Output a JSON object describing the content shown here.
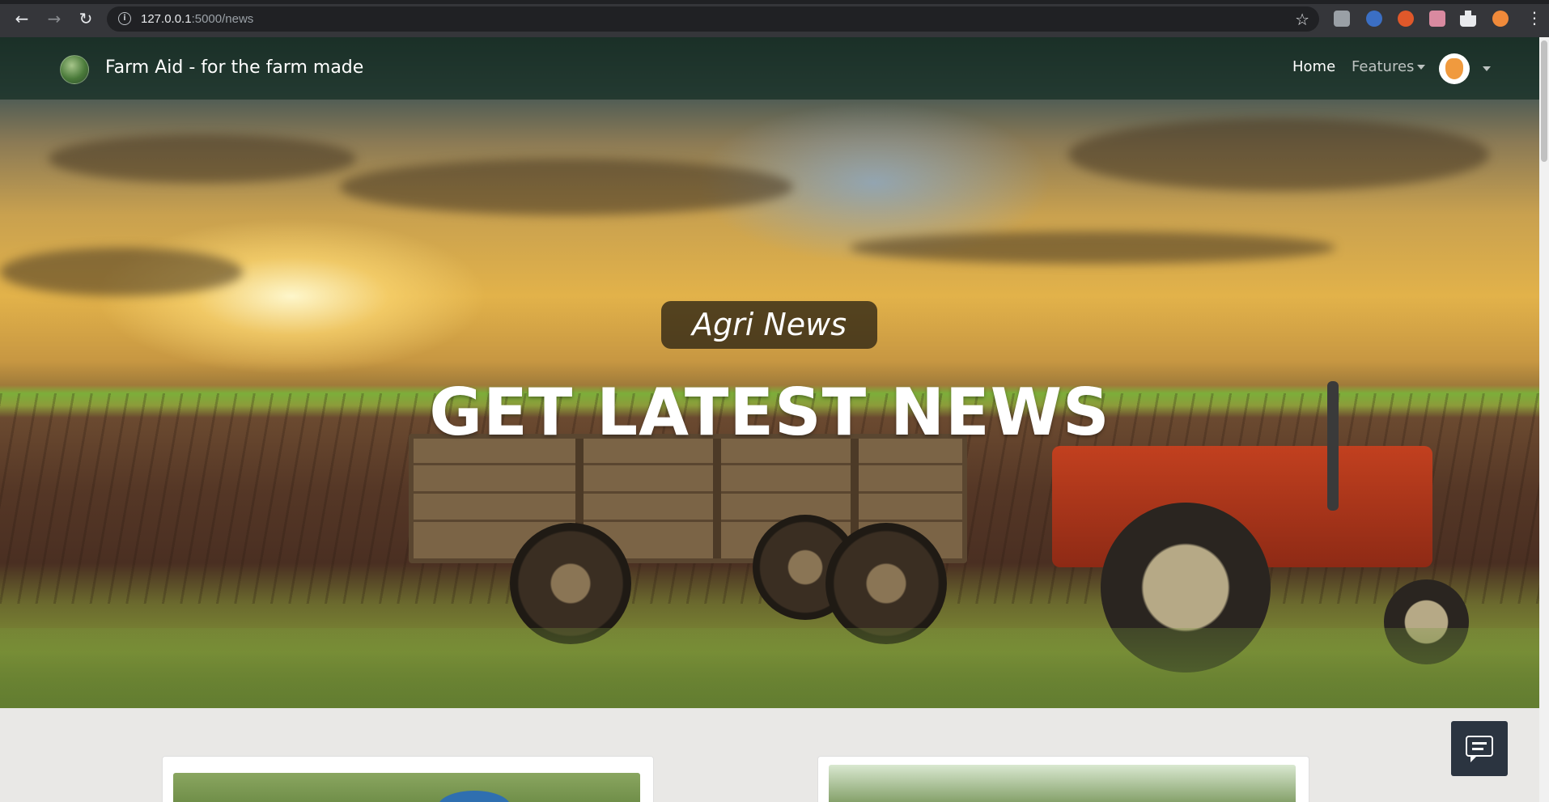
{
  "browser": {
    "url_host": "127.0.0.1",
    "url_path": ":5000/news"
  },
  "navbar": {
    "brand": "Farm Aid - for the farm made",
    "home_label": "Home",
    "features_label": "Features"
  },
  "hero": {
    "badge": "Agri News",
    "title": "GET LATEST NEWS"
  },
  "icons": {
    "back": "arrow-left-icon",
    "forward": "arrow-right-icon",
    "reload": "reload-icon",
    "bookmark": "star-icon",
    "chat": "chat-icon"
  },
  "colors": {
    "chrome_bg": "#35363a",
    "navbar_overlay": "#142d23",
    "chat_button": "#2b3440",
    "page_bg": "#e9e8e6"
  }
}
